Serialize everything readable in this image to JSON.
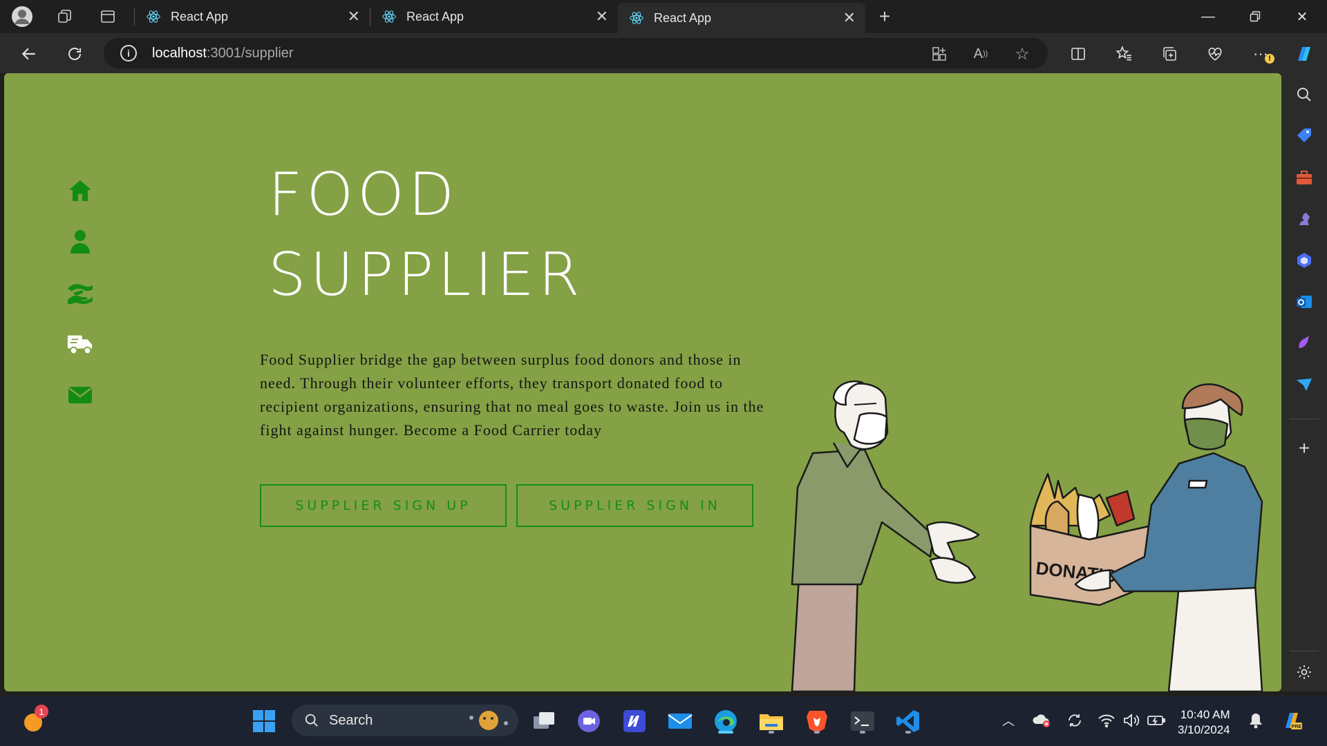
{
  "browser": {
    "tabs": [
      {
        "title": "React App",
        "active": false
      },
      {
        "title": "React App",
        "active": false
      },
      {
        "title": "React App",
        "active": true
      }
    ],
    "url_host": "localhost",
    "url_rest": ":3001/supplier"
  },
  "sidenav": {
    "items": [
      "home-icon",
      "user-icon",
      "hand-holding-icon",
      "truck-icon",
      "envelope-icon"
    ],
    "icon_color": "#138c13"
  },
  "hero": {
    "title_line1": "FOOD",
    "title_line2": "SUPPLIER",
    "description": "Food Supplier bridge the gap between surplus food donors and those in need. Through their volunteer efforts, they transport donated food to recipient organizations, ensuring that no meal goes to waste. Join us in the fight against hunger. Become a Food Carrier today",
    "signup_label": "SUPPLIER SIGN UP",
    "signin_label": "SUPPLIER SIGN IN",
    "box_label": "DONATIO"
  },
  "colors": {
    "page_background": "#84a145",
    "button_accent": "#168d16",
    "title": "#ffffff"
  },
  "taskbar": {
    "search_placeholder": "Search",
    "notification_badge": "1",
    "time": "10:40 AM",
    "date": "3/10/2024"
  }
}
